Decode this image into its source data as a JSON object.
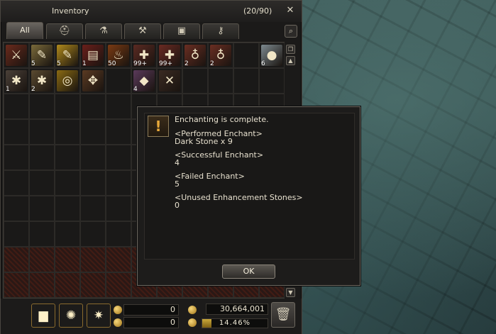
{
  "inventory": {
    "title": "Inventory",
    "count": "(20/90)",
    "tabs": [
      {
        "label": "All",
        "icon": "all-tab"
      },
      {
        "label": "",
        "icon": "armor-helmet-icon"
      },
      {
        "label": "",
        "icon": "potion-flask-icon"
      },
      {
        "label": "",
        "icon": "hammer-icon"
      },
      {
        "label": "",
        "icon": "box-icon"
      },
      {
        "label": "",
        "icon": "key-icon"
      }
    ],
    "items": [
      {
        "slot": 0,
        "name": "sword-icon",
        "glyph": "⚔",
        "color": "#6a2a1c",
        "qty": ""
      },
      {
        "slot": 1,
        "name": "map-scroll-icon",
        "glyph": "✎",
        "color": "#7a6a3a",
        "qty": "5"
      },
      {
        "slot": 2,
        "name": "gold-scroll-icon",
        "glyph": "✎",
        "color": "#b08a1c",
        "qty": "5"
      },
      {
        "slot": 3,
        "name": "ticket-icon",
        "glyph": "▤",
        "color": "#6a1f1a",
        "qty": "1"
      },
      {
        "slot": 4,
        "name": "red-potion-icon",
        "glyph": "♨",
        "color": "#7a3a12",
        "qty": "50"
      },
      {
        "slot": 5,
        "name": "syringe-icon",
        "glyph": "✚",
        "color": "#5a2a22",
        "qty": "99+"
      },
      {
        "slot": 6,
        "name": "syringe-icon",
        "glyph": "✚",
        "color": "#6a2a22",
        "qty": "99+"
      },
      {
        "slot": 7,
        "name": "blue-drink-icon",
        "glyph": "♁",
        "color": "#6a2e22",
        "qty": "2"
      },
      {
        "slot": 8,
        "name": "red-drink-icon",
        "glyph": "♁",
        "color": "#6a2e22",
        "qty": "2"
      },
      {
        "slot": 10,
        "name": "pearl-icon",
        "glyph": "●",
        "color": "#7d8a8f",
        "qty": "6"
      },
      {
        "slot": 11,
        "name": "gear-cluster-icon",
        "glyph": "✱",
        "color": "#4a4038",
        "qty": "1"
      },
      {
        "slot": 12,
        "name": "ore-cluster-icon",
        "glyph": "✱",
        "color": "#5a4a30",
        "qty": "2"
      },
      {
        "slot": 13,
        "name": "gold-coins-icon",
        "glyph": "◎",
        "color": "#8a6a12",
        "qty": ""
      },
      {
        "slot": 14,
        "name": "feather-icon",
        "glyph": "✥",
        "color": "#5a3a22",
        "qty": ""
      },
      {
        "slot": 16,
        "name": "dark-stone-icon",
        "glyph": "◆",
        "color": "#5a3a5a",
        "qty": "4"
      },
      {
        "slot": 17,
        "name": "crossed-weapons-icon",
        "glyph": "✕",
        "color": "#3a2a22",
        "qty": ""
      }
    ],
    "footer": {
      "buttons": [
        {
          "name": "anvil-button",
          "glyph": "▆",
          "color": "#5a4a3a"
        },
        {
          "name": "flame-swirl-button",
          "glyph": "✺",
          "color": "#8a4a12"
        },
        {
          "name": "sparkle-button",
          "glyph": "✷",
          "color": "#c08a1a"
        }
      ],
      "field_one": "0",
      "field_two": "0",
      "silver": "30,664,001",
      "weight_percent": "14.46%",
      "weight_fraction": 0.1446
    }
  },
  "dialog": {
    "headline": "Enchanting is complete.",
    "performed_label": "<Performed Enchant>",
    "performed_value": "Dark Stone x 9",
    "success_label": "<Successful Enchant>",
    "success_value": "4",
    "failed_label": "<Failed Enchant>",
    "failed_value": "5",
    "unused_label": "<Unused Enhancement Stones>",
    "unused_value": "0",
    "ok_label": "OK"
  }
}
